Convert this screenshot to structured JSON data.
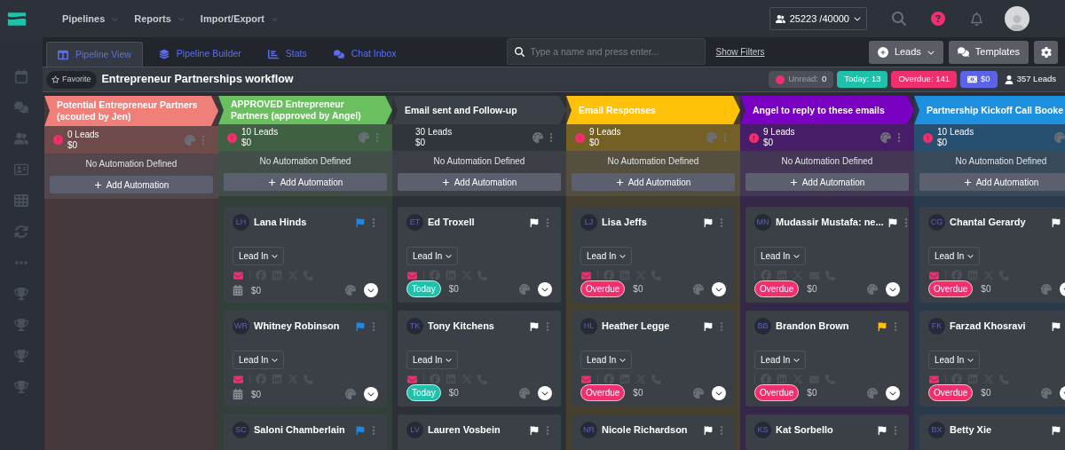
{
  "top_nav": {
    "menus": [
      "Pipelines",
      "Reports",
      "Import/Export"
    ],
    "lead_quota": "25223 /40000"
  },
  "tabs": [
    {
      "label": "Pipeline View",
      "selected": true
    },
    {
      "label": "Pipeline Builder",
      "selected": false
    },
    {
      "label": "Stats",
      "selected": false
    },
    {
      "label": "Chat Inbox",
      "selected": false
    }
  ],
  "search": {
    "placeholder": "Type a name and press enter..."
  },
  "show_filters": "Show Filters",
  "buttons": {
    "leads": "Leads",
    "templates": "Templates"
  },
  "pipeline": {
    "favorite": "Favorite",
    "title": "Entrepreneur Partnerships workflow",
    "stats": [
      {
        "kind": "unread",
        "label": "Unread:",
        "value": "0"
      },
      {
        "kind": "today",
        "label": "Today: 13"
      },
      {
        "kind": "overdue",
        "label": "Overdue: 141"
      },
      {
        "kind": "money",
        "label": "$0"
      },
      {
        "kind": "leads",
        "label": "357 Leads"
      }
    ]
  },
  "columns": [
    {
      "title": "Potential Entrepreneur Partners (scouted by Jen)",
      "color": "#f07f79",
      "leads": "0 Leads",
      "amount": "$0",
      "alert": true,
      "automation": "No Automation Defined",
      "add_automation": "Add Automation"
    },
    {
      "title": "APPROVED Entrepreneur Partners (approved by Angel)",
      "color": "#6abf5e",
      "leads": "10 Leads",
      "amount": "$0",
      "alert": true,
      "automation": "No Automation Defined",
      "add_automation": "Add Automation",
      "cards": [
        {
          "initials": "LH",
          "name": "Lana Hinds",
          "color": "#1e88e5",
          "status": "Lead In",
          "email_active": true,
          "due": {
            "kind": "none"
          },
          "amount": "$0"
        },
        {
          "initials": "WR",
          "name": "Whitney Robinson",
          "color": "#1e88e5",
          "status": "Lead In",
          "email_active": true,
          "due": {
            "kind": "none"
          },
          "amount": "$0"
        },
        {
          "initials": "SC",
          "name": "Saloni Chamberlain",
          "color": "#1e88e5"
        }
      ]
    },
    {
      "title": "Email sent and Follow-up",
      "color": "#3b4048",
      "leads": "30 Leads",
      "amount": "$0",
      "alert": false,
      "automation": "No Automation Defined",
      "add_automation": "Add Automation",
      "cards": [
        {
          "initials": "ET",
          "name": "Ed Troxell",
          "color": "#ffffff",
          "status": "Lead In",
          "email_active": true,
          "due": {
            "kind": "today",
            "label": "Today"
          },
          "amount": "$0"
        },
        {
          "initials": "TK",
          "name": "Tony Kitchens",
          "color": "#ffffff",
          "status": "Lead In",
          "email_active": true,
          "due": {
            "kind": "today",
            "label": "Today"
          },
          "amount": "$0"
        },
        {
          "initials": "LV",
          "name": "Lauren Vosbein",
          "color": "#ffffff"
        }
      ]
    },
    {
      "title": "Email Responses",
      "color": "#ffc107",
      "leads": "9 Leads",
      "amount": "$0",
      "alert": true,
      "automation": "No Automation Defined",
      "add_automation": "Add Automation",
      "cards": [
        {
          "initials": "LJ",
          "name": "Lisa Jeffs",
          "color": "#ffffff",
          "status": "Lead In",
          "email_active": true,
          "due": {
            "kind": "overdue",
            "label": "Overdue"
          },
          "amount": "$0"
        },
        {
          "initials": "HL",
          "name": "Heather Legge",
          "color": "#ffffff",
          "status": "Lead In",
          "email_active": true,
          "due": {
            "kind": "overdue",
            "label": "Overdue"
          },
          "amount": "$0"
        },
        {
          "initials": "NR",
          "name": "Nicole Richardson",
          "color": "#ffffff"
        }
      ]
    },
    {
      "title": "Angel to reply to these emails",
      "color": "#7a00c2",
      "leads": "9 Leads",
      "amount": "$0",
      "alert": true,
      "automation": "No Automation Defined",
      "add_automation": "Add Automation",
      "cards": [
        {
          "initials": "MN",
          "name": "Mudassir Mustafa: ne...",
          "color": "#ffffff",
          "status": "Lead In",
          "email_active": false,
          "due": {
            "kind": "overdue",
            "label": "Overdue"
          },
          "amount": "$0"
        },
        {
          "initials": "BB",
          "name": "Brandon Brown",
          "color": "#ffc107",
          "status": "Lead In",
          "email_active": false,
          "due": {
            "kind": "overdue",
            "label": "Overdue"
          },
          "amount": "$0"
        },
        {
          "initials": "KS",
          "name": "Kat Sorbello",
          "color": "#ffffff"
        }
      ]
    },
    {
      "title": "Partnership Kickoff Call Booke",
      "color": "#1e90e0",
      "leads": "10 Leads",
      "amount": "$0",
      "alert": true,
      "automation": "No Automation Defined",
      "add_automation": "Add Automation",
      "cards": [
        {
          "initials": "CG",
          "name": "Chantal Gerardy",
          "color": "#ffffff",
          "status": "Lead In",
          "email_active": true,
          "due": {
            "kind": "overdue",
            "label": "Overdue"
          },
          "amount": "$0"
        },
        {
          "initials": "FK",
          "name": "Farzad Khosravi",
          "color": "#ffffff",
          "status": "Lead In",
          "email_active": true,
          "due": {
            "kind": "overdue",
            "label": "Overdue"
          },
          "amount": "$0"
        },
        {
          "initials": "BX",
          "name": "Betty Xie",
          "color": "#ffffff"
        }
      ]
    }
  ]
}
